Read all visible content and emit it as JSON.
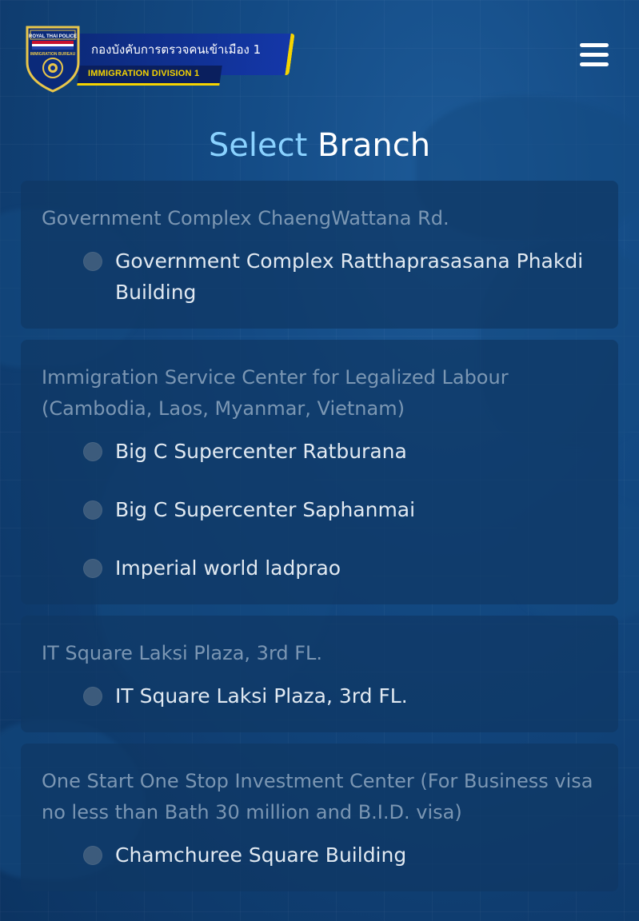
{
  "header": {
    "logo_title": "กองบังคับการตรวจคนเข้าเมือง 1",
    "logo_subtitle": "IMMIGRATION DIVISION 1",
    "badge_text_top": "ROYAL THAI POLICE",
    "badge_text_mid": "IMMIGRATION BUREAU",
    "menu_icon": "hamburger-menu-icon"
  },
  "page": {
    "title_accent": "Select",
    "title_main": "Branch"
  },
  "colors": {
    "background": "#134a84",
    "accent": "#8ad2ff",
    "card_bg": "#0f3764",
    "logo_yellow": "#f5d400"
  },
  "groups": [
    {
      "title": "Government Complex ChaengWattana Rd.",
      "options": [
        {
          "label": "Government Complex Ratthaprasasana Phakdi Building",
          "selected": false
        }
      ]
    },
    {
      "title": "Immigration Service Center for Legalized Labour (Cambodia, Laos, Myanmar, Vietnam)",
      "options": [
        {
          "label": "Big C Supercenter Ratburana",
          "selected": false
        },
        {
          "label": "Big C Supercenter Saphanmai",
          "selected": false
        },
        {
          "label": "Imperial world ladprao",
          "selected": false
        }
      ]
    },
    {
      "title": "IT Square Laksi Plaza, 3rd FL.",
      "options": [
        {
          "label": "IT Square Laksi Plaza, 3rd FL.",
          "selected": false
        }
      ]
    },
    {
      "title": "One Start One Stop Investment Center (For Business visa no less than Bath 30 million and B.I.D. visa)",
      "options": [
        {
          "label": "Chamchuree Square Building",
          "selected": false
        }
      ]
    }
  ]
}
